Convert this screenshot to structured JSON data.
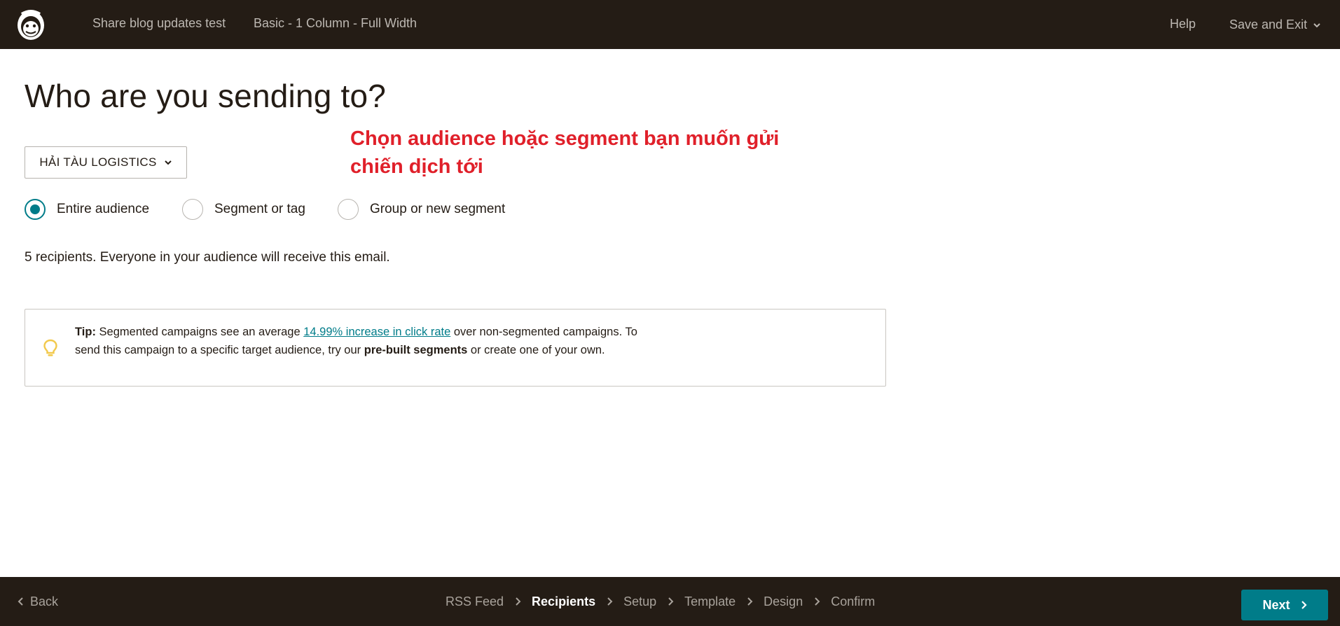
{
  "header": {
    "breadcrumbs": [
      "Share blog updates test",
      "Basic - 1 Column - Full Width"
    ],
    "help_label": "Help",
    "save_exit_label": "Save and Exit"
  },
  "main": {
    "title": "Who are you sending to?",
    "audience_selected": "HẢI TÀU LOGISTICS",
    "annotation": "Chọn audience hoặc segment bạn muốn gửi chiến dịch tới",
    "radio_options": [
      {
        "label": "Entire audience",
        "checked": true
      },
      {
        "label": "Segment or tag",
        "checked": false
      },
      {
        "label": "Group or new segment",
        "checked": false
      }
    ],
    "recipients_count": "5",
    "recipients_text": " recipients. Everyone in your audience will receive this email.",
    "tip": {
      "label": "Tip:",
      "text_1": " Segmented campaigns see an average ",
      "link": "14.99% increase in click rate",
      "text_2": " over non-segmented campaigns. To send this campaign to a specific target audience, try our ",
      "bold": "pre-built segments",
      "text_3": " or create one of your own."
    }
  },
  "footer": {
    "back_label": "Back",
    "steps": [
      "RSS Feed",
      "Recipients",
      "Setup",
      "Template",
      "Design",
      "Confirm"
    ],
    "active_step": "Recipients",
    "next_label": "Next"
  },
  "colors": {
    "dark_bar": "#241c15",
    "accent": "#007c89",
    "annotation": "#e0202a",
    "tip_icon": "#f2c94c"
  },
  "icons": [
    "freddie-logo-icon",
    "chevron-down-icon",
    "lightbulb-icon",
    "chevron-left-icon",
    "chevron-right-icon"
  ]
}
